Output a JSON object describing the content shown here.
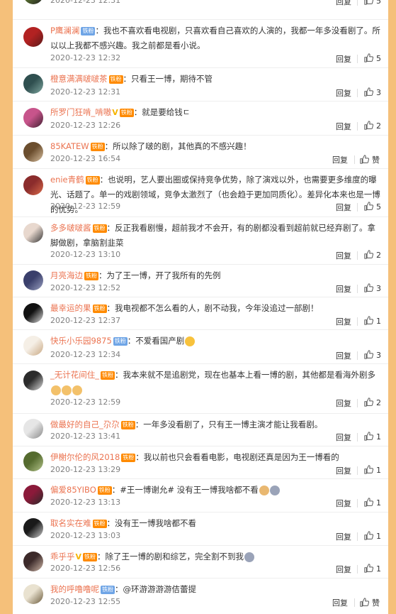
{
  "comments": [
    {
      "name": "",
      "badges": [],
      "colon": "",
      "text": "",
      "time": "2020-12-23 12:31",
      "reply": "回复",
      "likes": "5"
    },
    {
      "name": "P鹰澜澜",
      "badges": [
        {
          "type": "iron",
          "text": "铁粉"
        }
      ],
      "colon": "：",
      "text": "我也不喜欢看电视剧，只喜欢看自己喜欢的人演的，我都一年多没看剧了。所以以上我都不感兴趣。我之前都是看小说。",
      "time": "2020-12-23 12:32",
      "reply": "回复",
      "likes": "5"
    },
    {
      "name": "橙意满满啵啵茶",
      "badges": [
        {
          "type": "fan",
          "text": "铁粉"
        }
      ],
      "colon": "：",
      "text": "只看王一博，期待不管",
      "time": "2020-12-23 12:31",
      "reply": "回复",
      "likes": "3"
    },
    {
      "name": "所罗门狂啃_啃嗷",
      "badges": [
        {
          "type": "fan",
          "text": "铁粉"
        }
      ],
      "colon": "：",
      "text": "就是要给钱ㄷ",
      "time": "2020-12-23 12:26",
      "reply": "回复",
      "likes": "2"
    },
    {
      "name": "85KATEW",
      "badges": [
        {
          "type": "fan",
          "text": "铁粉"
        }
      ],
      "colon": "：",
      "text": "所以除了啵的剧，其他真的不感兴趣！",
      "time": "2020-12-23 16:54",
      "reply": "回复",
      "likes": "赞"
    },
    {
      "name": "enie青鹤",
      "badges": [
        {
          "type": "fan",
          "text": "铁粉"
        }
      ],
      "colon": "：",
      "text": "也说明，艺人要出圈或保持竞争优势，除了演戏以外，也需要更多维度的曝光、话题了。单一的戏剧领域，竞争太激烈了（也会趋于更加同质化）。差异化本来也是一博的优势。",
      "time": "2020-12-23 12:59",
      "reply": "回复",
      "likes": "5"
    },
    {
      "name": "多多啵啵酱",
      "badges": [
        {
          "type": "fan",
          "text": "铁粉"
        }
      ],
      "colon": "：",
      "text": "反正我看剧慢，超前我才不会开，有的剧都没看到超前就已经弃剧了。拿脚做剧，拿脑割韭菜",
      "time": "2020-12-23 13:10",
      "reply": "回复",
      "likes": "2"
    },
    {
      "name": "月亮海边",
      "badges": [
        {
          "type": "fan",
          "text": "铁粉"
        }
      ],
      "colon": "：",
      "text": "为了王一博，开了我所有的先例",
      "time": "2020-12-23 12:52",
      "reply": "回复",
      "likes": "3"
    },
    {
      "name": "最幸运的果",
      "badges": [
        {
          "type": "fan",
          "text": "铁粉"
        }
      ],
      "colon": "：",
      "text": "我电视都不怎么看的人，剧不动我，今年没追过一部剧！",
      "time": "2020-12-23 12:37",
      "reply": "回复",
      "likes": "1"
    },
    {
      "name": "快乐小乐园9875",
      "badges": [
        {
          "type": "iron",
          "text": "铁粉"
        }
      ],
      "colon": "：",
      "text": "不爱看国产剧",
      "time": "2020-12-23 12:34",
      "reply": "回复",
      "likes": "3"
    },
    {
      "name": "_无计花间住_",
      "badges": [
        {
          "type": "fan",
          "text": "铁粉"
        }
      ],
      "colon": "：",
      "text": "我本来就不是追剧党，现在也基本上看一博的剧，其他都是看海外剧多",
      "time": "2020-12-23 12:59",
      "reply": "回复",
      "likes": "2"
    },
    {
      "name": "做最好的自己_尕尕",
      "badges": [
        {
          "type": "fan",
          "text": "铁粉"
        }
      ],
      "colon": "：",
      "text": "一年多没看剧了，只有王一博主演才能让我看剧。",
      "time": "2020-12-23 13:41",
      "reply": "回复",
      "likes": "1"
    },
    {
      "name": "伊榭尔伦的风2018",
      "badges": [
        {
          "type": "fan",
          "text": "铁粉"
        }
      ],
      "colon": "：",
      "text": "我以前也只会看看电影，电视剧还真是因为王一博看的",
      "time": "2020-12-23 13:29",
      "reply": "回复",
      "likes": "1"
    },
    {
      "name": "偏爱85YIBO",
      "badges": [
        {
          "type": "fan",
          "text": "铁粉"
        }
      ],
      "colon": "：",
      "text": "#王一博谢允# 没有王一博我啥都不看",
      "time": "2020-12-23 13:13",
      "reply": "回复",
      "likes": "1"
    },
    {
      "name": "取名实在难",
      "badges": [
        {
          "type": "fan",
          "text": "铁粉"
        }
      ],
      "colon": "：",
      "text": "没有王一博我啥都不看",
      "time": "2020-12-23 13:03",
      "reply": "回复",
      "likes": "1"
    },
    {
      "name": "乖乎乎",
      "badges": [
        {
          "type": "fan",
          "text": "铁粉"
        }
      ],
      "colon": "：",
      "text": "除了王一博的剧和综艺，完全割不到我",
      "time": "2020-12-23 12:56",
      "reply": "回复",
      "likes": "1"
    },
    {
      "name": "我的呼噜噜呢",
      "badges": [
        {
          "type": "iron",
          "text": "铁粉"
        }
      ],
      "colon": "：",
      "text": "@环游游游游佶蕾提",
      "time": "2020-12-23 12:55",
      "reply": "回复",
      "likes": "赞"
    }
  ],
  "colors": {
    "username": "#eb7350",
    "background": "#f5c07a",
    "fan_badge": "#ff8a00",
    "iron_badge": "#6fa5e6"
  },
  "icons": {
    "like": "thumbs-up-icon",
    "verified": "vip-v-icon"
  }
}
